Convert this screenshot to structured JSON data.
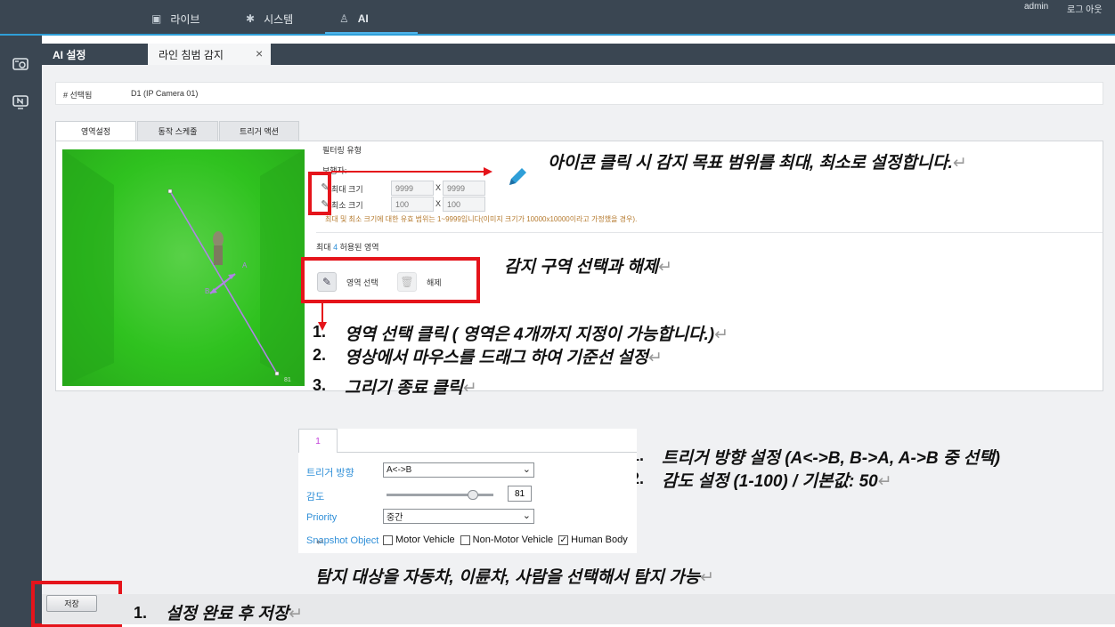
{
  "topnav": {
    "live": "라이브",
    "system": "시스템",
    "ai": "AI",
    "user": "admin",
    "logout": "로그 아웃"
  },
  "tabs": {
    "ai_settings": "AI 설정",
    "line_intrusion": "라인 침범 감지",
    "close": "×"
  },
  "selected": {
    "label": "# 선택됨",
    "value": "D1 (IP Camera 01)"
  },
  "subtabs": [
    "영역설정",
    "동작 스케줄",
    "트리거 액션"
  ],
  "filter": {
    "title": "필터링 유형",
    "target": "보행자:",
    "max_label": "최대 크기",
    "min_label": "최소 크기",
    "max_w": "9999",
    "max_h": "9999",
    "min_w": "100",
    "min_h": "100",
    "times": "X",
    "note": "최대 및 최소 크기에 대한 유효 범위는 1~9999입니다(이미지 크기가 10000x10000이라고 가정했을 경우)."
  },
  "area": {
    "max_prefix": "최대",
    "max_count": "4",
    "max_suffix": "허용된 영역",
    "select_label": "영역 선택",
    "clear_label": "해제"
  },
  "video": {
    "label_a": "A",
    "label_b": "B",
    "corner": "81"
  },
  "annotations": {
    "icon_note": "아이콘 클릭 시 감지 목표 범위를 최대, 최소로 설정합니다.",
    "area_note": "감지 구역 선택과 해제",
    "step1": "영역 선택 클릭 ( 영역은 4개까지 지정이 가능합니다.)",
    "step2": "영상에서 마우스를 드래그 하여 기준선 설정",
    "step3": "그리기 종료 클릭",
    "trigger1": "트리거 방향 설정 (A<->B, B->A, A->B  중 선택)",
    "trigger2": "감도 설정 (1-100)  /  기본값: 50",
    "object_note": "탐지 대상을 자동차, 이륜차, 사람을 선택해서 탐지 가능",
    "save_note": "설정 완료 후 저장",
    "n1": "1.",
    "n2": "2.",
    "n3": "3.",
    "ret": "↵"
  },
  "trigger": {
    "tab": "1",
    "direction_label": "트리거 방향",
    "direction_value": "A<->B",
    "sensitivity_label": "감도",
    "sensitivity_value": "81",
    "sensitivity_fraction": 0.81,
    "priority_label": "Priority",
    "priority_value": "중간",
    "snapshot_label": "Snapshot Object",
    "motor": "Motor Vehicle",
    "nonmotor": "Non-Motor Vehicle",
    "human": "Human Body",
    "motor_checked": false,
    "nonmotor_checked": false,
    "human_checked": true
  },
  "save": "저장",
  "colors": {
    "accent": "#2f9fd8",
    "highlight": "#e5141b",
    "line": "#b083e6"
  }
}
